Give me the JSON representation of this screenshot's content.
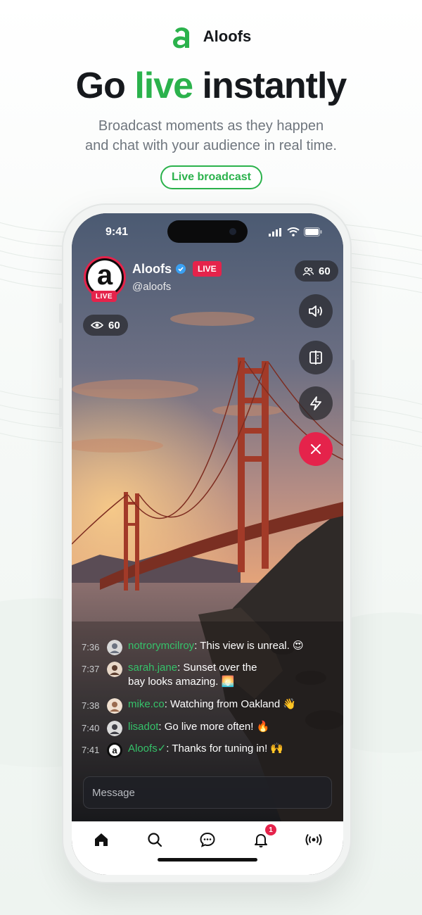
{
  "brand": {
    "name": "Aloofs",
    "color": "#2bb24c"
  },
  "hero": {
    "headline_pre": "Go ",
    "headline_accent": "live",
    "headline_post": " instantly",
    "sub_line1": "Broadcast moments as they happen",
    "sub_line2": "and chat with your audience in real time.",
    "pill": "Live broadcast"
  },
  "status_bar": {
    "time": "9:41"
  },
  "stream": {
    "avatar_letter": "a",
    "avatar_live": "LIVE",
    "name": "Aloofs",
    "live_badge": "LIVE",
    "handle": "@aloofs",
    "viewers": "60",
    "participants": "60"
  },
  "controls": {
    "speaker": "speaker-icon",
    "flip": "flip-camera-icon",
    "flash": "flash-icon",
    "close": "close-icon"
  },
  "chat": [
    {
      "time": "7:36",
      "user": "notrorymcilroy",
      "text": "This view is unreal. 😍"
    },
    {
      "time": "7:37",
      "user": "sarah.jane",
      "text": "Sunset over the bay looks amazing. 🌅"
    },
    {
      "time": "7:38",
      "user": "mike.co",
      "text": "Watching from Oakland 👋"
    },
    {
      "time": "7:40",
      "user": "lisadot",
      "text": "Go live more often! 🔥"
    },
    {
      "time": "7:41",
      "user": "Aloofs",
      "verified_mark": "✓",
      "text": "Thanks for tuning in! 🙌"
    }
  ],
  "message_placeholder": "Message",
  "tabbar": {
    "items": [
      "home-icon",
      "search-icon",
      "chat-icon",
      "bell-icon",
      "broadcast-icon"
    ],
    "notification_count": "1"
  },
  "colors": {
    "live_red": "#e5234b",
    "accent_green": "#2bb24c"
  }
}
